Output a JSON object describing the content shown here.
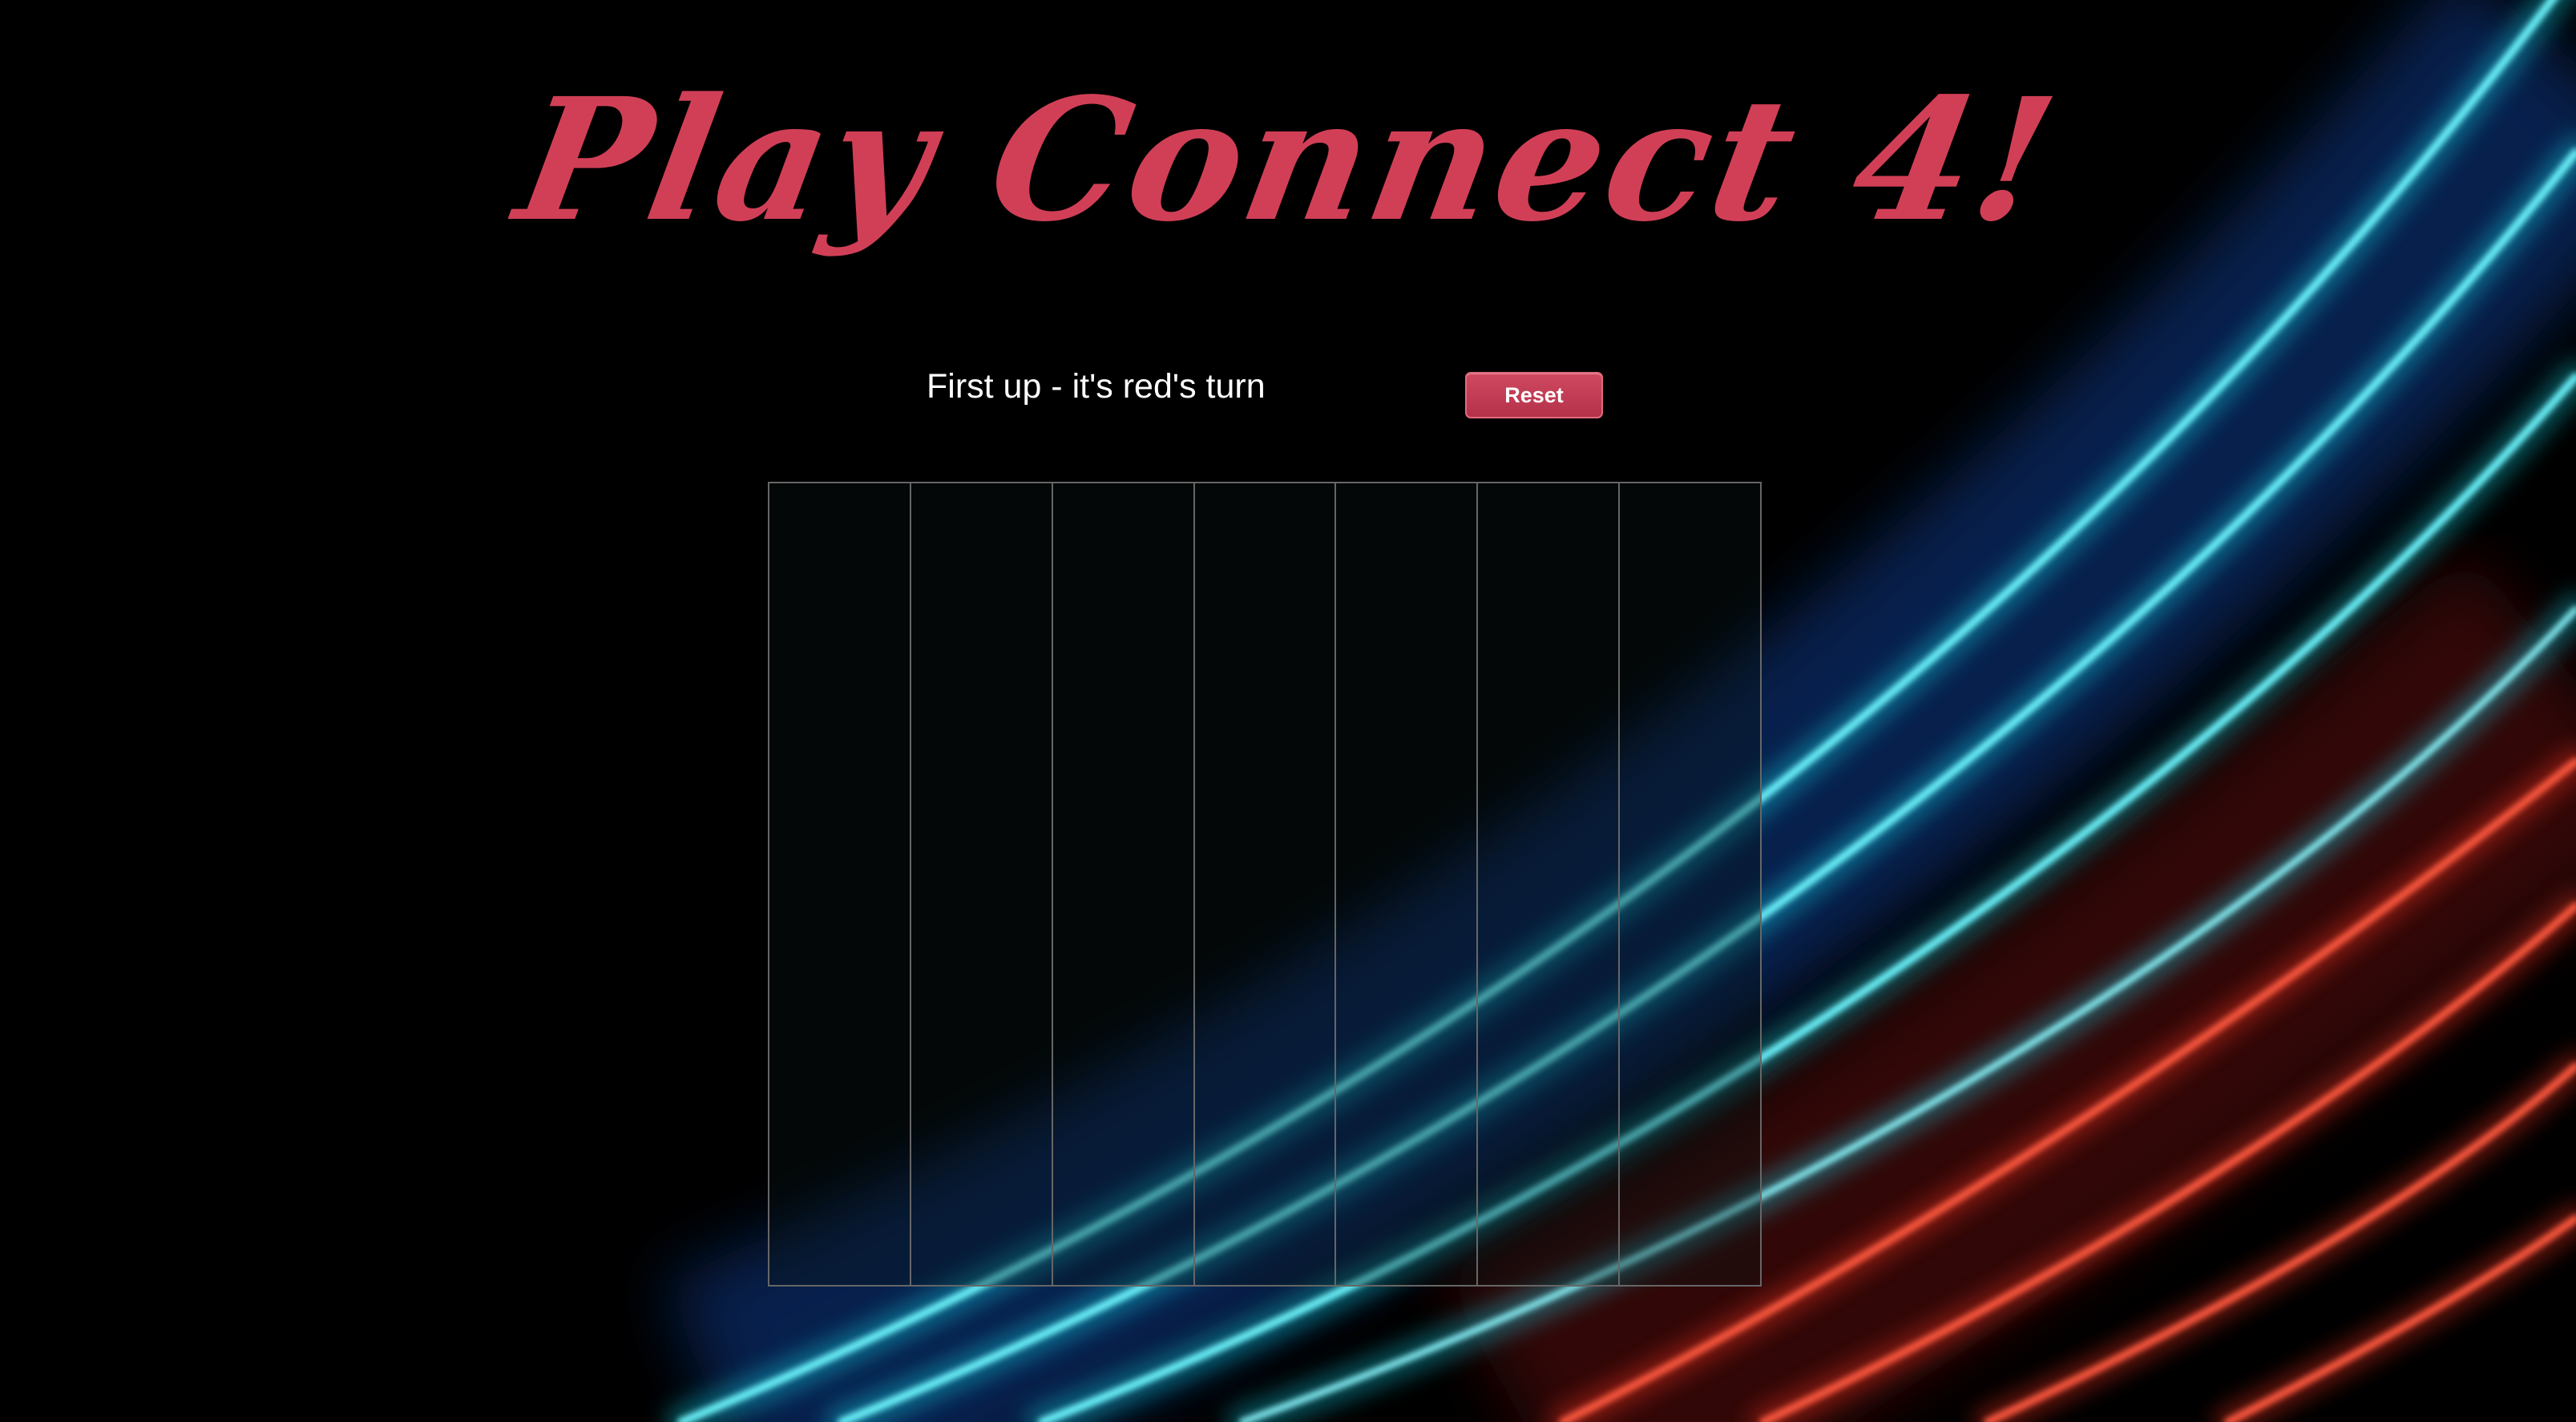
{
  "page": {
    "title": "Play Connect 4!"
  },
  "status": {
    "text": "First up - it's red's turn"
  },
  "controls": {
    "reset_label": "Reset"
  },
  "board": {
    "columns": 7,
    "rows_filled": 0,
    "cells": []
  },
  "colors": {
    "title": "#d13f57",
    "button": "#c23b54",
    "grid_line": "#666666",
    "background": "#000000",
    "neon_blue": "#19f0ff",
    "neon_red": "#ff3522"
  },
  "background": {
    "theme": "neon light streaks (blue and red)"
  }
}
